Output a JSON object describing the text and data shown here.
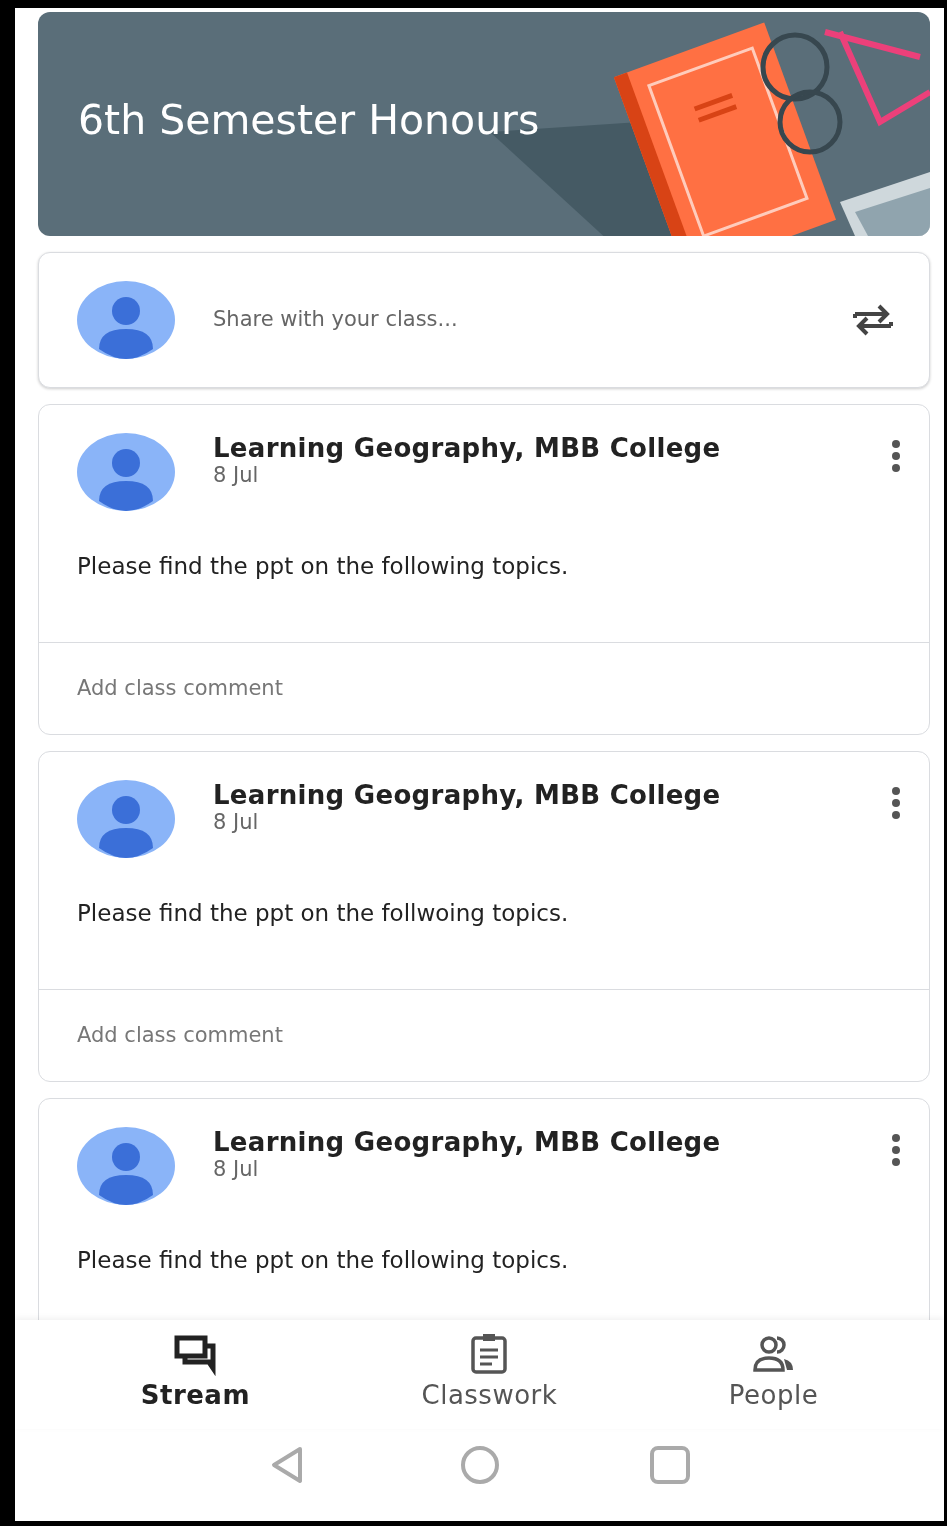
{
  "banner": {
    "title": "6th Semester Honours"
  },
  "share": {
    "placeholder": "Share with your class..."
  },
  "posts": [
    {
      "author": "Learning Geography, MBB College",
      "date": "8 Jul",
      "text": "Please find the ppt on the following topics.",
      "comment_placeholder": "Add class comment"
    },
    {
      "author": "Learning Geography, MBB College",
      "date": "8 Jul",
      "text": "Please find the ppt on the follwoing topics.",
      "comment_placeholder": "Add class comment"
    },
    {
      "author": "Learning Geography, MBB College",
      "date": "8 Jul",
      "text": "Please find the ppt on the following topics."
    }
  ],
  "tabs": [
    {
      "kind": "stream",
      "label": "Stream",
      "selected": true
    },
    {
      "kind": "classwork",
      "label": "Classwork",
      "selected": false
    },
    {
      "kind": "people",
      "label": "People",
      "selected": false
    }
  ]
}
